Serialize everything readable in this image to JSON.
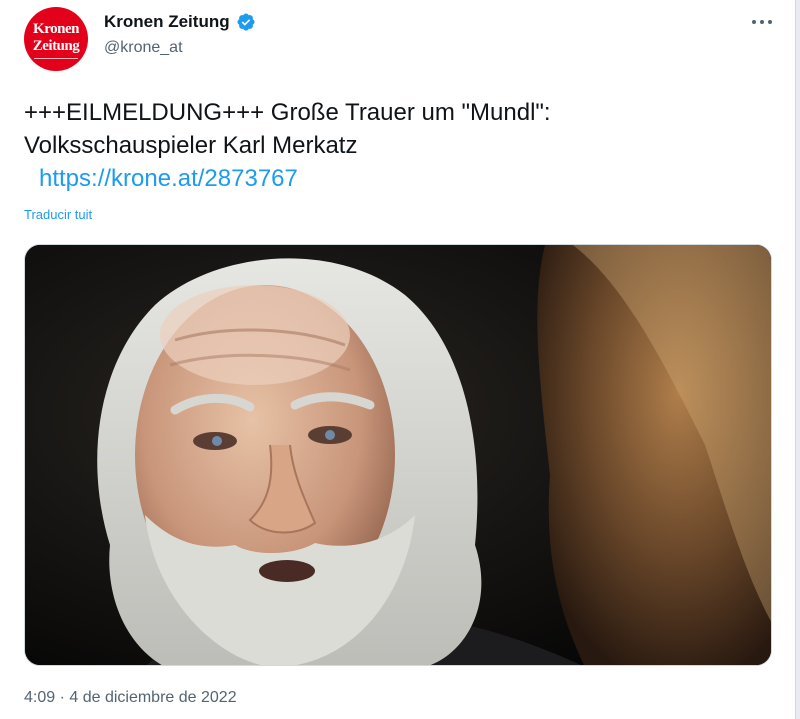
{
  "account": {
    "logo_line1": "Kronen",
    "logo_line2": "Zeitung",
    "display_name": "Kronen Zeitung",
    "handle": "@krone_at",
    "verified_icon": "verified-badge-icon",
    "brand_color": "#e2001a",
    "verified_color": "#1d9bf0"
  },
  "tweet": {
    "line1": "+++EILMELDUNG+++ Große Trauer um \"Mundl\":",
    "line2": "Volksschauspieler Karl Merkatz",
    "link": "https://krone.at/2873767",
    "translate_label": "Traducir tuit",
    "timestamp": "4:09 · 4 de diciembre de 2022"
  },
  "colors": {
    "text": "#0f1419",
    "secondary": "#536471",
    "link": "#1d9bf0"
  }
}
